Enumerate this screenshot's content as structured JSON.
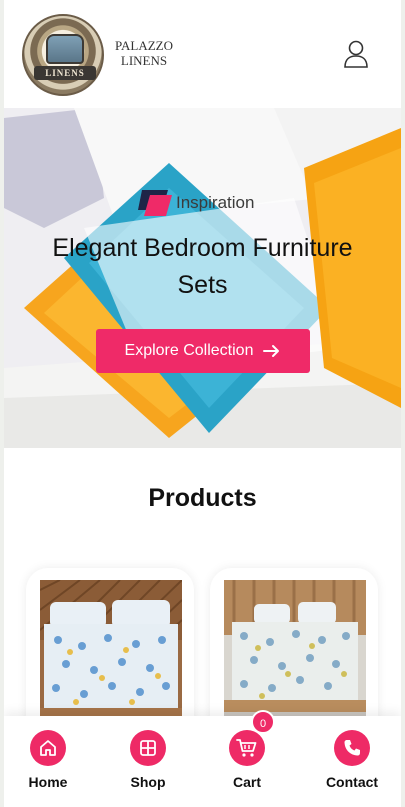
{
  "header": {
    "brand_line1": "PALAZZO",
    "brand_line2": "LINENS",
    "logo_band": "LINENS"
  },
  "hero": {
    "badge": "Inspiration",
    "title": "Elegant Bedroom Furniture Sets",
    "cta_label": "Explore Collection",
    "accent_color": "#ef2a68"
  },
  "products": {
    "title": "Products"
  },
  "bottom_nav": {
    "items": [
      {
        "label": "Home",
        "icon": "home-icon"
      },
      {
        "label": "Shop",
        "icon": "grid-icon"
      },
      {
        "label": "Cart",
        "icon": "cart-icon"
      },
      {
        "label": "Contact",
        "icon": "phone-icon"
      }
    ],
    "cart_count": "0"
  }
}
